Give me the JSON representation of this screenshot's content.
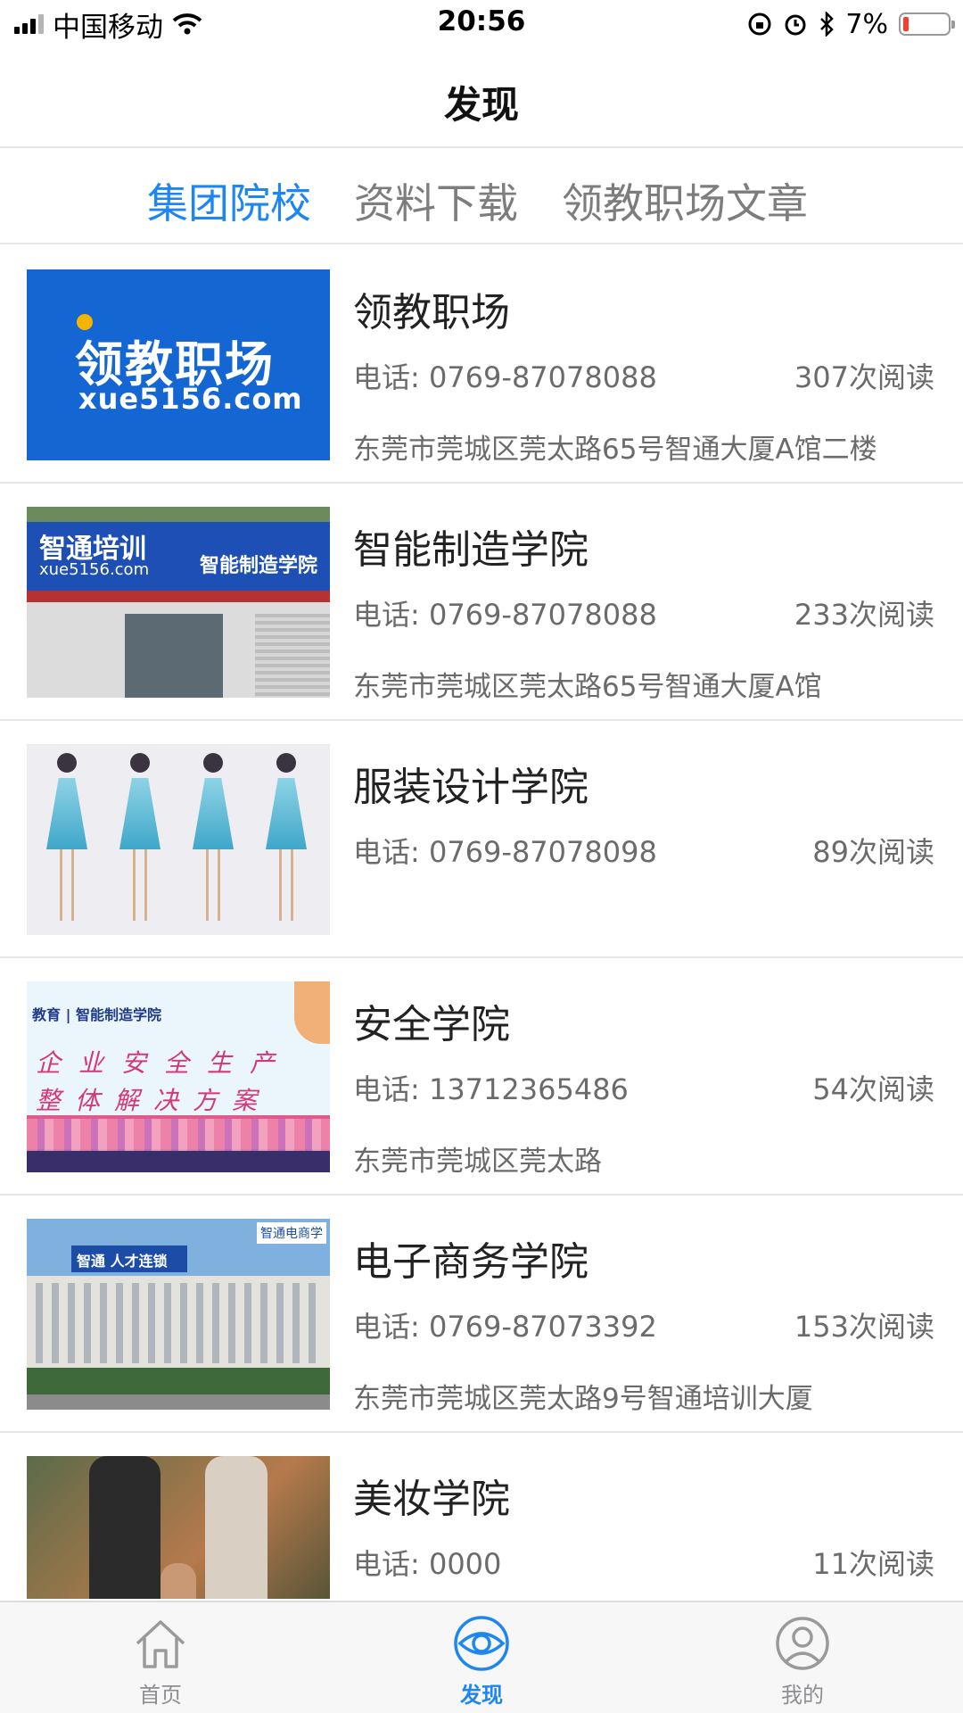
{
  "status_bar": {
    "carrier": "中国移动",
    "time": "20:56",
    "battery_percent": "7%"
  },
  "nav": {
    "title": "发现"
  },
  "tabs": [
    {
      "label": "集团院校",
      "active": true
    },
    {
      "label": "资料下载",
      "active": false
    },
    {
      "label": "领教职场文章",
      "active": false
    }
  ],
  "schools": [
    {
      "name": "领教职场",
      "phone": "电话: 0769-87078088",
      "reads": "307次阅读",
      "address": "东莞市莞城区莞太路65号智通大厦A馆二楼",
      "thumb_text": {
        "title": "领教职场",
        "sub": "xue5156.com"
      }
    },
    {
      "name": "智能制造学院",
      "phone": "电话: 0769-87078088",
      "reads": "233次阅读",
      "address": "东莞市莞城区莞太路65号智通大厦A馆",
      "thumb_text": {
        "title": "智通培训",
        "sub": "xue5156.com",
        "side": "智能制造学院"
      }
    },
    {
      "name": "服装设计学院",
      "phone": "电话: 0769-87078098",
      "reads": "89次阅读",
      "address": ""
    },
    {
      "name": "安全学院",
      "phone": "电话: 13712365486",
      "reads": "54次阅读",
      "address": "东莞市莞城区莞太路",
      "thumb_text": {
        "header": "教育 | 智能制造学院",
        "line1": "企业安全生产",
        "line2": "整体解决方案"
      }
    },
    {
      "name": "电子商务学院",
      "phone": "电话: 0769-87073392",
      "reads": "153次阅读",
      "address": "东莞市莞城区莞太路9号智通培训大厦",
      "thumb_text": {
        "sign": "智通 人才连锁",
        "corner": "智通电商学"
      }
    },
    {
      "name": "美妆学院",
      "phone": "电话: 0000",
      "reads": "11次阅读",
      "address": ""
    }
  ],
  "tabbar": [
    {
      "label": "首页",
      "icon": "home-icon",
      "active": false
    },
    {
      "label": "发现",
      "icon": "eye-icon",
      "active": true
    },
    {
      "label": "我的",
      "icon": "user-icon",
      "active": false
    }
  ],
  "colors": {
    "accent": "#1e86f0",
    "text_secondary": "#6b6b6b",
    "battery_low": "#ff3b30"
  }
}
